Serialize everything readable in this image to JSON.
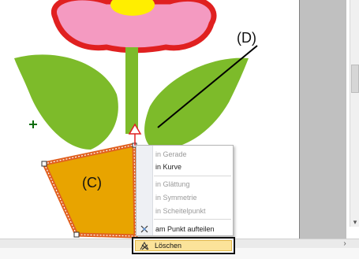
{
  "labels": {
    "c": "(C)",
    "d": "(D)"
  },
  "context_menu": {
    "items": [
      {
        "label": "in Gerade",
        "enabled": false
      },
      {
        "label": "in Kurve",
        "enabled": true
      },
      {
        "label": "in Glättung",
        "enabled": false
      },
      {
        "label": "in Symmetrie",
        "enabled": false
      },
      {
        "label": "in Scheitelpunkt",
        "enabled": false
      },
      {
        "label": "am Punkt aufteilen",
        "enabled": true,
        "icon": "split-point-icon"
      }
    ],
    "highlighted": {
      "label": "Löschen",
      "icon": "delete-point-icon"
    }
  },
  "colors": {
    "petal": "#f49ac1",
    "petal_outline": "#e02020",
    "flower_center": "#ffee00",
    "leaf": "#7dbb2a",
    "pot": "#e8a400",
    "pot_outline": "#e06020",
    "menu_highlight": "#fbe39a"
  },
  "icons": {
    "crosshair": "plus-crosshair-icon",
    "scroll_down": "chevron-down-icon",
    "scroll_right": "chevron-right-icon"
  }
}
